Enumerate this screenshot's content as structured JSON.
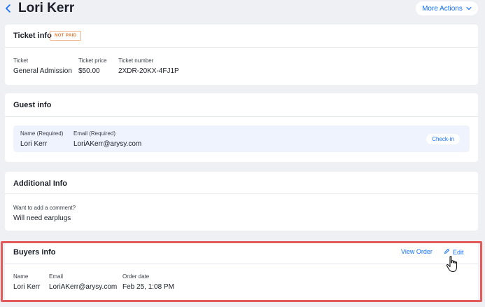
{
  "header": {
    "title": "Lori Kerr",
    "more_actions_label": "More Actions"
  },
  "ticket_info": {
    "title": "Ticket info",
    "status_badge": "NOT PAID",
    "fields": [
      {
        "label": "Ticket",
        "value": "General Admission"
      },
      {
        "label": "Ticket price",
        "value": "$50.00"
      },
      {
        "label": "Ticket number",
        "value": "2XDR-20KX-4FJ1P"
      }
    ]
  },
  "guest_info": {
    "title": "Guest info",
    "fields": [
      {
        "label": "Name (Required)",
        "value": "Lori Kerr"
      },
      {
        "label": "Email (Required)",
        "value": "LoriAKerr@arysy.com"
      }
    ],
    "checkin_label": "Check-in"
  },
  "additional_info": {
    "title": "Additional Info",
    "question": "Want to add a comment?",
    "answer": "Will need earplugs"
  },
  "buyers_info": {
    "title": "Buyers info",
    "view_order_label": "View Order",
    "edit_label": "Edit",
    "fields": [
      {
        "label": "Name",
        "value": "Lori Kerr"
      },
      {
        "label": "Email",
        "value": "LoriAKerr@arysy.com"
      },
      {
        "label": "Order date",
        "value": "Feb 25, 1:08 PM"
      }
    ]
  },
  "colors": {
    "accent": "#116dff",
    "badge": "#e6762f",
    "highlight": "#e35a5a",
    "background": "#eef0f4"
  },
  "icons": [
    "chevron-left-icon",
    "chevron-down-icon",
    "pencil-icon",
    "hand-cursor-icon"
  ]
}
